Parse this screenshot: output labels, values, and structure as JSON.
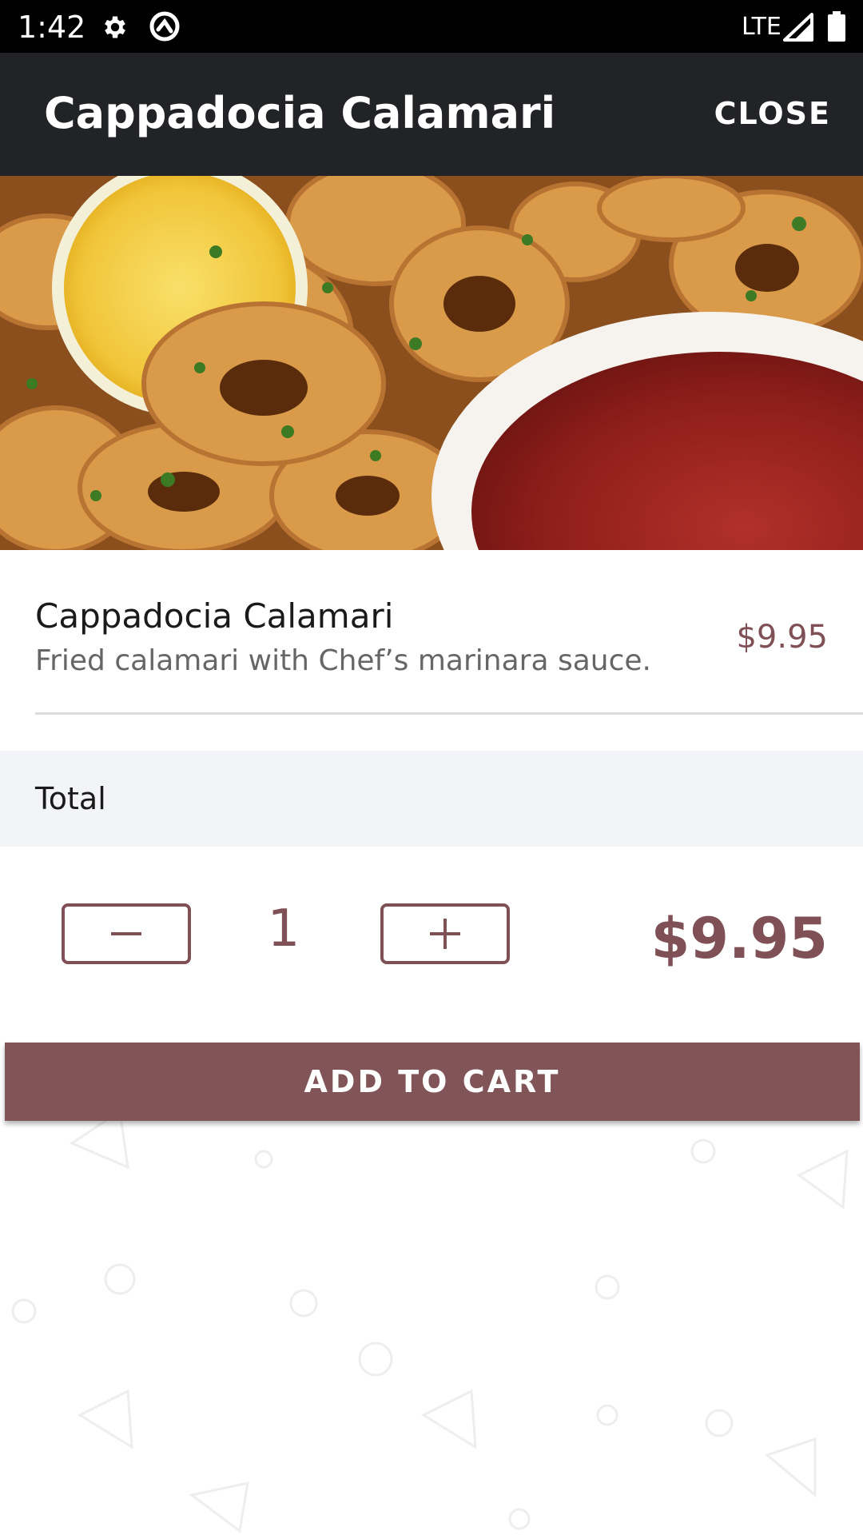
{
  "status_bar": {
    "time": "1:42",
    "network": "LTE",
    "icons": [
      "gear-icon",
      "sync-icon",
      "signal-icon",
      "battery-icon"
    ]
  },
  "app_bar": {
    "title": "Cappadocia Calamari",
    "close_label": "CLOSE"
  },
  "item": {
    "name": "Cappadocia Calamari",
    "description": "Fried calamari with Chef’s marinara sauce.",
    "price": "$9.95"
  },
  "total": {
    "label": "Total",
    "quantity": "1",
    "amount": "$9.95"
  },
  "actions": {
    "add_to_cart_label": "ADD TO CART"
  },
  "colors": {
    "accent": "#7f5055",
    "button": "#815558",
    "appbar": "#222326",
    "total_bar": "#f3f4f7"
  }
}
